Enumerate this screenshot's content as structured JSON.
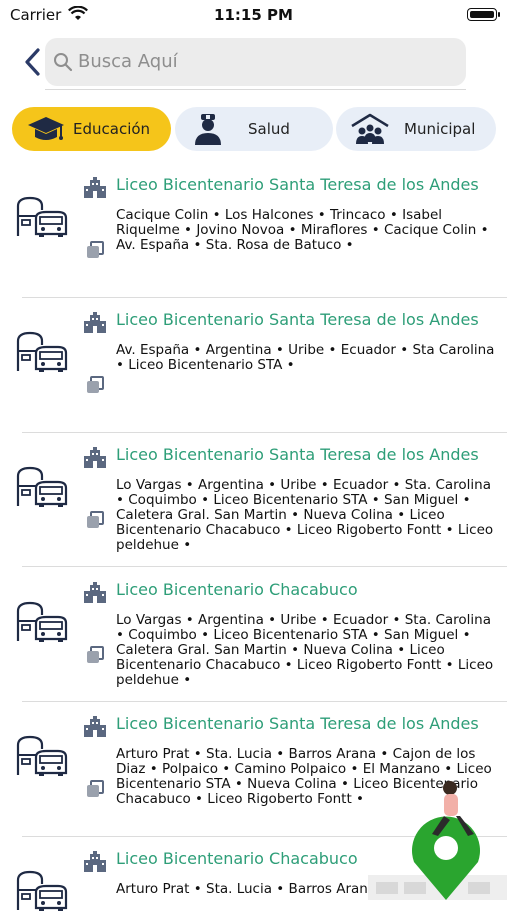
{
  "status_bar": {
    "carrier": "Carrier",
    "time": "11:15 PM"
  },
  "search": {
    "placeholder": "Busca Aquí"
  },
  "tabs": [
    {
      "label": "Educación",
      "icon": "graduation-cap-icon",
      "active": true
    },
    {
      "label": "Salud",
      "icon": "nurse-icon",
      "active": false
    },
    {
      "label": "Municipal",
      "icon": "community-icon",
      "active": false
    }
  ],
  "routes": [
    {
      "title": "Liceo Bicentenario Santa Teresa de los Andes",
      "stops": "Cacique Colin • Los Halcones • Trincaco • Isabel Riquelme • Jovino Novoa • Miraflores • Cacique Colin • Av. España • Sta. Rosa de Batuco •"
    },
    {
      "title": "Liceo Bicentenario Santa Teresa de los Andes",
      "stops": "Av. España • Argentina • Uribe • Ecuador • Sta Carolina • Liceo Bicentenario STA •"
    },
    {
      "title": "Liceo Bicentenario Santa Teresa de los Andes",
      "stops": "Lo Vargas • Argentina • Uribe • Ecuador • Sta. Carolina • Coquimbo • Liceo Bicentenario STA • San Miguel • Caletera Gral. San Martin • Nueva Colina • Liceo Bicentenario Chacabuco • Liceo Rigoberto Fontt • Liceo peldehue •"
    },
    {
      "title": "Liceo Bicentenario Chacabuco",
      "stops": "Lo Vargas • Argentina • Uribe • Ecuador • Sta. Carolina • Coquimbo • Liceo Bicentenario STA • San Miguel • Caletera Gral. San Martin • Nueva Colina • Liceo Bicentenario Chacabuco • Liceo Rigoberto Fontt • Liceo peldehue •"
    },
    {
      "title": "Liceo Bicentenario Santa Teresa de los Andes",
      "stops": "Arturo Prat • Sta. Lucia • Barros Arana • Cajon de los Diaz • Polpaico • Camino Polpaico • El Manzano • Liceo Bicentenario STA • Nueva Colina • Liceo Bicentenario Chacabuco • Liceo Rigoberto Fontt •"
    },
    {
      "title": "Liceo Bicentenario Chacabuco",
      "stops": "Arturo Prat • Sta. Lucia • Barros Arana •"
    }
  ],
  "colors": {
    "accent_green": "#2e9e78",
    "active_tab": "#f5c51a",
    "tab_bg": "#e8eef7",
    "fab_green": "#2aa52f"
  }
}
